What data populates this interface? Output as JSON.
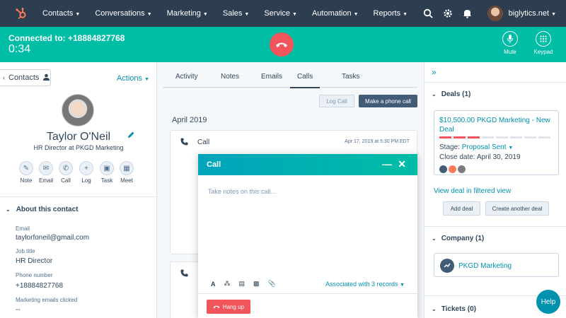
{
  "nav": {
    "items": [
      "Contacts",
      "Conversations",
      "Marketing",
      "Sales",
      "Service",
      "Automation",
      "Reports"
    ],
    "account": "biglytics.net"
  },
  "callbar": {
    "connected": "Connected to: +18884827768",
    "timer": "0:34",
    "mute": "Mute",
    "keypad": "Keypad"
  },
  "contact": {
    "back_label": "Contacts",
    "actions_label": "Actions",
    "name": "Taylor O'Neil",
    "title": "HR Director at PKGD Marketing",
    "quick_actions": [
      "Note",
      "Email",
      "Call",
      "Log",
      "Task",
      "Meet"
    ],
    "about_heading": "About this contact",
    "fields": [
      {
        "label": "Email",
        "value": "taylorfoneil@gmail.com"
      },
      {
        "label": "Job title",
        "value": "HR Director"
      },
      {
        "label": "Phone number",
        "value": "+18884827768"
      },
      {
        "label": "Marketing emails clicked",
        "value": "--"
      }
    ]
  },
  "center": {
    "tabs": [
      "Activity",
      "Notes",
      "Emails",
      "Calls",
      "Tasks"
    ],
    "active_tab": "Calls",
    "log_call": "Log Call",
    "make_call": "Make a phone call",
    "month": "April 2019",
    "card_title": "Call",
    "card_date": "Apr 17, 2019 at 5:30 PM EDT"
  },
  "modal": {
    "title": "Call",
    "placeholder": "Take notes on this call...",
    "associated": "Associated with 3 records",
    "hang_up": "Hang up"
  },
  "right": {
    "deals_heading": "Deals (1)",
    "deal_name": "$10,500.00 PKGD Marketing - New Deal",
    "stage_label": "Stage:",
    "stage_value": "Proposal Sent",
    "close_date": "Close date: April 30, 2019",
    "view_deal": "View deal in filtered view",
    "add_deal": "Add deal",
    "create_deal": "Create another deal",
    "company_heading": "Company (1)",
    "company_name": "PKGD Marketing",
    "tickets_heading": "Tickets (0)",
    "help": "Help"
  },
  "colors": {
    "nav_bg": "#2d3e50",
    "call_bar": "#00bda5",
    "hangup": "#f2545b",
    "link": "#0091ae",
    "brand_orange": "#ff7a59"
  }
}
